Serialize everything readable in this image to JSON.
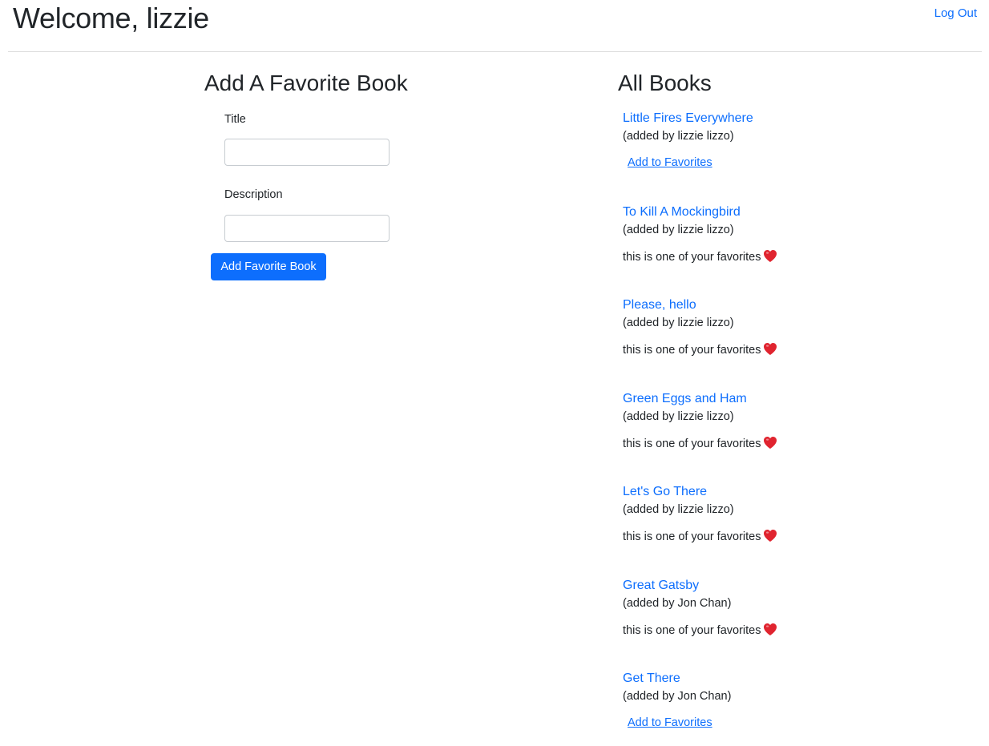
{
  "header": {
    "welcome_text": "Welcome, lizzie",
    "logout_label": "Log Out"
  },
  "form": {
    "title": "Add A Favorite Book",
    "title_label": "Title",
    "title_value": "",
    "description_label": "Description",
    "description_value": "",
    "submit_label": "Add Favorite Book"
  },
  "books": {
    "title": "All Books",
    "items": [
      {
        "title": "Little Fires Everywhere",
        "added_by": "(added by lizzie lizzo)",
        "is_favorite": false,
        "action_label": "Add to Favorites"
      },
      {
        "title": "To Kill A Mockingbird",
        "added_by": "(added by lizzie lizzo)",
        "is_favorite": true,
        "favorite_note": "this is one of your favorites"
      },
      {
        "title": "Please, hello",
        "added_by": "(added by lizzie lizzo)",
        "is_favorite": true,
        "favorite_note": "this is one of your favorites"
      },
      {
        "title": "Green Eggs and Ham",
        "added_by": "(added by lizzie lizzo)",
        "is_favorite": true,
        "favorite_note": "this is one of your favorites"
      },
      {
        "title": "Let's Go There",
        "added_by": "(added by lizzie lizzo)",
        "is_favorite": true,
        "favorite_note": "this is one of your favorites"
      },
      {
        "title": "Great Gatsby",
        "added_by": "(added by Jon Chan)",
        "is_favorite": true,
        "favorite_note": "this is one of your favorites"
      },
      {
        "title": "Get There",
        "added_by": "(added by Jon Chan)",
        "is_favorite": false,
        "action_label": "Add to Favorites"
      }
    ]
  },
  "icons": {
    "favorite": "heart-icon"
  },
  "colors": {
    "link": "#0d6efd",
    "button": "#0d6efd",
    "heart": "#e0242f",
    "text": "#212529"
  }
}
